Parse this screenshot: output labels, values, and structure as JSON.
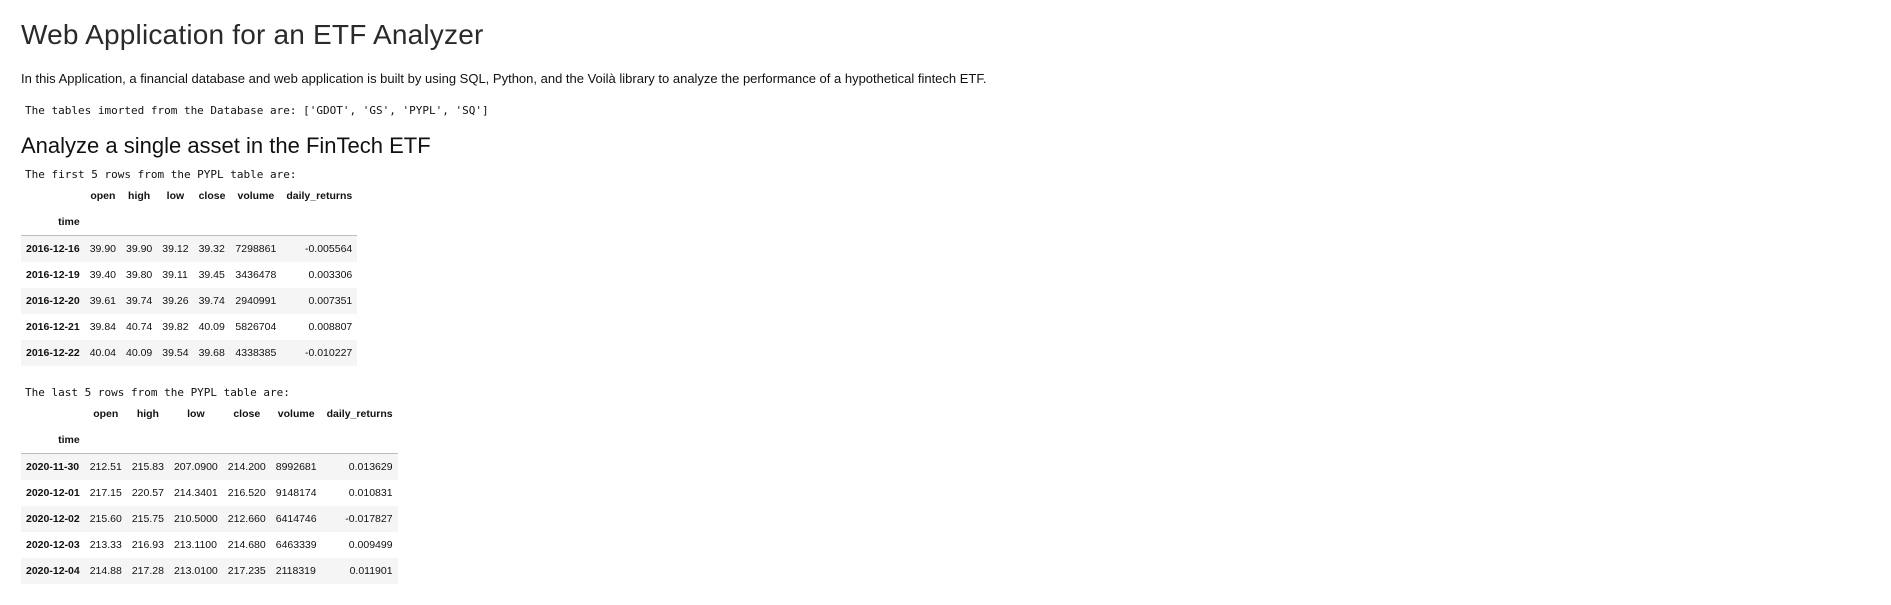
{
  "page": {
    "title": "Web Application for an ETF Analyzer",
    "intro": "In this Application, a financial database and web application is built by using SQL, Python, and the Voilà library to analyze the performance of a hypothetical fintech ETF.",
    "tables_line": "The tables imorted from the Database are: ['GDOT', 'GS', 'PYPL', 'SQ']",
    "section_title": "Analyze a single asset in the FinTech ETF"
  },
  "first_table": {
    "caption": "The first 5 rows from the PYPL table are:",
    "index_name": "time",
    "columns": [
      "open",
      "high",
      "low",
      "close",
      "volume",
      "daily_returns"
    ],
    "rows": [
      {
        "index": "2016-12-16",
        "cells": [
          "39.90",
          "39.90",
          "39.12",
          "39.32",
          "7298861",
          "-0.005564"
        ]
      },
      {
        "index": "2016-12-19",
        "cells": [
          "39.40",
          "39.80",
          "39.11",
          "39.45",
          "3436478",
          "0.003306"
        ]
      },
      {
        "index": "2016-12-20",
        "cells": [
          "39.61",
          "39.74",
          "39.26",
          "39.74",
          "2940991",
          "0.007351"
        ]
      },
      {
        "index": "2016-12-21",
        "cells": [
          "39.84",
          "40.74",
          "39.82",
          "40.09",
          "5826704",
          "0.008807"
        ]
      },
      {
        "index": "2016-12-22",
        "cells": [
          "40.04",
          "40.09",
          "39.54",
          "39.68",
          "4338385",
          "-0.010227"
        ]
      }
    ]
  },
  "last_table": {
    "caption": "The last 5 rows from the PYPL table are:",
    "index_name": "time",
    "columns": [
      "open",
      "high",
      "low",
      "close",
      "volume",
      "daily_returns"
    ],
    "rows": [
      {
        "index": "2020-11-30",
        "cells": [
          "212.51",
          "215.83",
          "207.0900",
          "214.200",
          "8992681",
          "0.013629"
        ]
      },
      {
        "index": "2020-12-01",
        "cells": [
          "217.15",
          "220.57",
          "214.3401",
          "216.520",
          "9148174",
          "0.010831"
        ]
      },
      {
        "index": "2020-12-02",
        "cells": [
          "215.60",
          "215.75",
          "210.5000",
          "212.660",
          "6414746",
          "-0.017827"
        ]
      },
      {
        "index": "2020-12-03",
        "cells": [
          "213.33",
          "216.93",
          "213.1100",
          "214.680",
          "6463339",
          "0.009499"
        ]
      },
      {
        "index": "2020-12-04",
        "cells": [
          "214.88",
          "217.28",
          "213.0100",
          "217.235",
          "2118319",
          "0.011901"
        ]
      }
    ]
  }
}
